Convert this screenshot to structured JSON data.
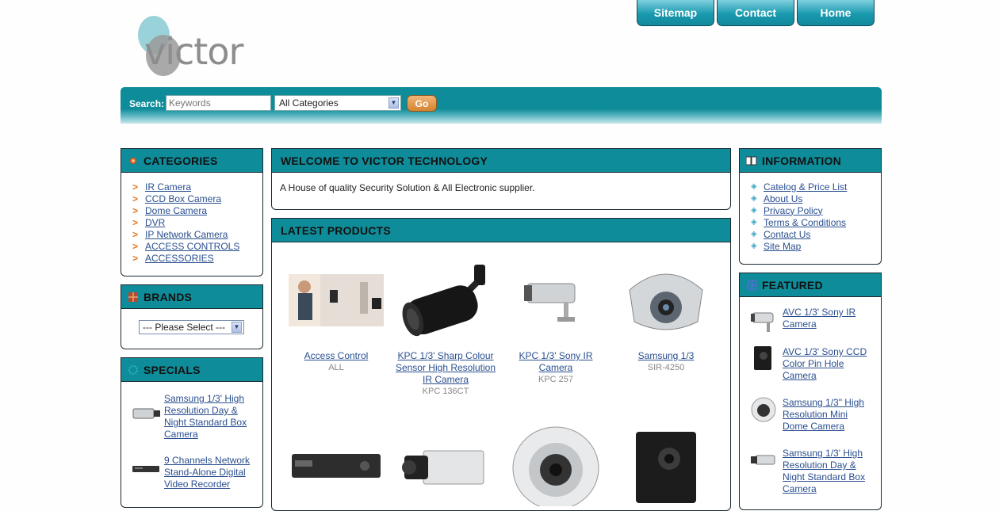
{
  "logo": {
    "text": "victor"
  },
  "top_nav": [
    "Sitemap",
    "Contact",
    "Home"
  ],
  "search": {
    "label": "Search:",
    "placeholder": "Keywords",
    "category_selected": "All Categories",
    "go_label": "Go"
  },
  "categories": {
    "title": "CATEGORIES",
    "items": [
      "IR Camera",
      "CCD Box Camera",
      "Dome Camera",
      "DVR",
      "IP Network Camera",
      "ACCESS CONTROLS",
      "ACCESSORIES"
    ]
  },
  "brands": {
    "title": "BRANDS",
    "select_value": "--- Please Select ---"
  },
  "specials": {
    "title": "SPECIALS",
    "items": [
      "Samsung 1/3' High Resolution Day & Night Standard Box Camera",
      "9 Channels Network Stand-Alone Digital Video Recorder"
    ]
  },
  "welcome": {
    "title": "WELCOME TO VICTOR TECHNOLOGY",
    "text": "A House of quality Security Solution & All Electronic supplier."
  },
  "latest": {
    "title": "LATEST PRODUCTS",
    "products": [
      {
        "name": "Access Control",
        "code": "ALL"
      },
      {
        "name": "KPC 1/3' Sharp Colour Sensor High Resolution IR Camera",
        "code": "KPC 136CT"
      },
      {
        "name": "KPC 1/3' Sony IR Camera",
        "code": "KPC 257"
      },
      {
        "name": "Samsung 1/3",
        "code": "SIR-4250"
      }
    ]
  },
  "information": {
    "title": "INFORMATION",
    "items": [
      "Catelog & Price List",
      "About Us",
      "Privacy Policy",
      "Terms & Conditions",
      "Contact Us",
      "Site Map"
    ]
  },
  "featured": {
    "title": "FEATURED",
    "items": [
      "AVC 1/3' Sony IR Camera",
      "AVC 1/3' Sony CCD Color Pin Hole Camera",
      "Samsung 1/3\" High Resolution Mini Dome Camera",
      "Samsung 1/3' High Resolution Day & Night Standard Box Camera"
    ]
  },
  "colors": {
    "teal": "#0f8c99",
    "link": "#2a4f8f",
    "go_button": "#d3822e"
  }
}
